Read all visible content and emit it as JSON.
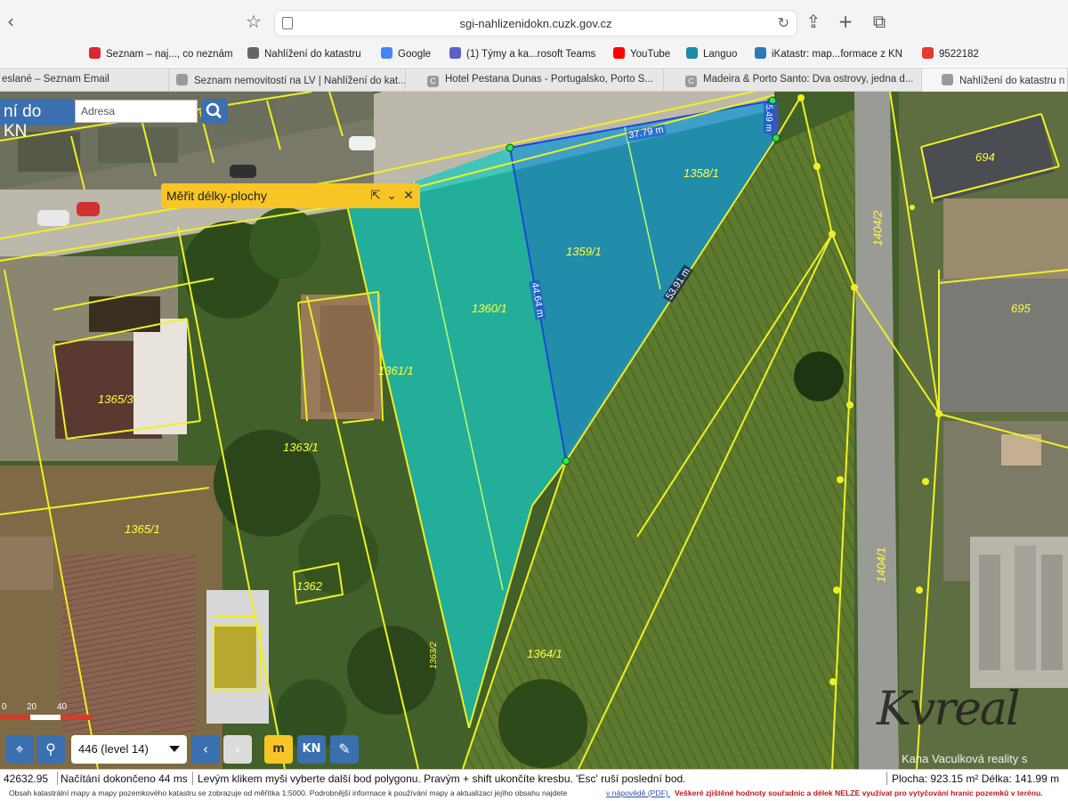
{
  "browser": {
    "url": "sgi-nahlizenidokn.cuzk.gov.cz",
    "bookmarks": [
      {
        "label": "Seznam – naj..., co neznám",
        "color": "#d9282f"
      },
      {
        "label": "Nahlížení do katastru",
        "color": "#666666"
      },
      {
        "label": "Google",
        "color": "#4285f4"
      },
      {
        "label": "(1) Týmy a ka...rosoft Teams",
        "color": "#5b5fc7"
      },
      {
        "label": "YouTube",
        "color": "#ff0000"
      },
      {
        "label": "Languo",
        "color": "#1e88a8"
      },
      {
        "label": "iKatastr: map...formace z KN",
        "color": "#2a7ab8"
      },
      {
        "label": "9522182",
        "color": "#e53935"
      }
    ],
    "tabs": [
      {
        "label": "eslané – Seznam Email"
      },
      {
        "label": "Seznam nemovitostí na LV | Nahlížení do kat..."
      },
      {
        "label": "Hotel Pestana Dunas - Portugalsko, Porto S..."
      },
      {
        "label": "Madeira & Porto Santo: Dva ostrovy, jedna d..."
      },
      {
        "label": "Nahlížení do katastru n"
      }
    ]
  },
  "app": {
    "title": "ní do KN",
    "search_placeholder": "Adresa",
    "measure_panel_title": "Měřit délky-plochy"
  },
  "map": {
    "parcels": [
      {
        "label": "1358/1"
      },
      {
        "label": "1359/1"
      },
      {
        "label": "1360/1"
      },
      {
        "label": "1361/1"
      },
      {
        "label": "1365/3"
      },
      {
        "label": "1363/1"
      },
      {
        "label": "1365/1"
      },
      {
        "label": "1362"
      },
      {
        "label": "1364/1"
      },
      {
        "label": "1363/2"
      },
      {
        "label": "1404/2"
      },
      {
        "label": "1404/1"
      },
      {
        "label": "694"
      },
      {
        "label": "695"
      }
    ],
    "measurements": {
      "top_edge": "37.79 m",
      "right_edge": "5.49 m",
      "middle_edge": "44.64 m",
      "diagonal_edge": "53.91 m"
    },
    "scale": {
      "a": "0",
      "b": "20",
      "c": "40"
    },
    "level_select": "446 (level 14)",
    "watermark_big": "Kvreal",
    "watermark_small": "Kana Vaculková reality s"
  },
  "statusbar": {
    "coords": "42632.95",
    "load": "Načítání dokončeno 44 ms",
    "hint": "Levým klikem myši vyberte další bod polygonu. Pravým + shift ukončíte kresbu. 'Esc' ruší poslední bod.",
    "result": "Plocha: 923.15 m² Délka: 141.99 m"
  },
  "footer": {
    "info": "Obsah katastrální mapy a mapy pozemkového katastru se zobrazuje od měřítka 1:5000. Podrobnější informace k používání mapy a aktualizaci jejího obsahu najdete",
    "link": "v nápovědě (PDF).",
    "warning": "Veškeré zjištěné hodnoty souřadnic a délek NELZE využívat pro vytyčování hranic pozemků v terénu."
  },
  "colors": {
    "accent_blue": "#3a6fb0",
    "measure_panel": "#f7c624",
    "parcel_boundary": "#f0f020",
    "selected_fill": "#19c8c0",
    "selected_fill_blue": "#1a9ad0"
  }
}
